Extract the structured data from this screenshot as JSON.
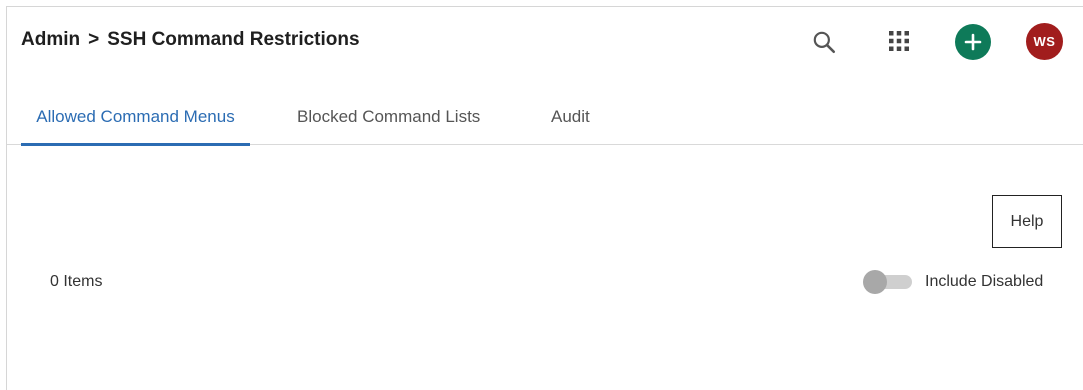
{
  "header": {
    "breadcrumb": {
      "root": "Admin",
      "separator": ">",
      "current": "SSH Command Restrictions"
    },
    "icons": {
      "search": "search-icon",
      "apps": "apps-grid-icon",
      "add": "plus-icon"
    },
    "avatar_initials": "WS",
    "colors": {
      "add_button": "#0e7a59",
      "avatar": "#a11d1d"
    }
  },
  "tabs": [
    {
      "label": "Allowed Command Menus",
      "active": true
    },
    {
      "label": "Blocked Command Lists",
      "active": false
    },
    {
      "label": "Audit",
      "active": false
    }
  ],
  "accent_color": "#2b6cb3",
  "main": {
    "help_label": "Help",
    "items_count": "0 Items",
    "include_disabled": {
      "label": "Include Disabled",
      "checked": false
    }
  }
}
